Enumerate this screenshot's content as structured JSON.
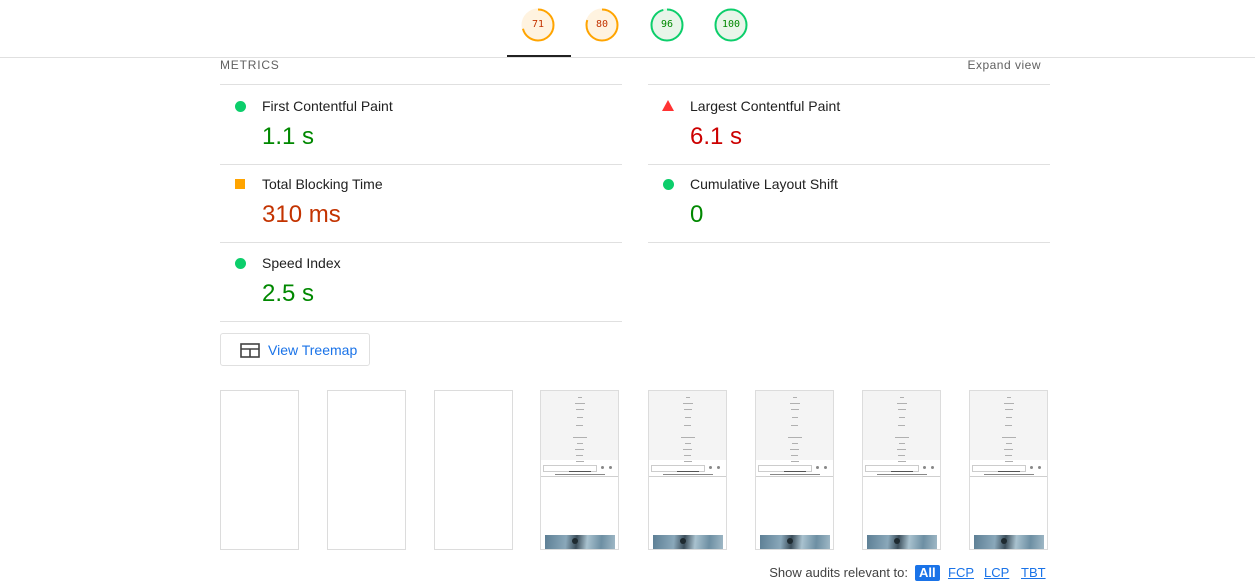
{
  "gauges": [
    {
      "score": "71",
      "color": "#ffa400",
      "fill": "#fff3e0",
      "text": "#c33300",
      "fraction": 0.71
    },
    {
      "score": "80",
      "color": "#ffa400",
      "fill": "#fff3e0",
      "text": "#c33300",
      "fraction": 0.8
    },
    {
      "score": "96",
      "color": "#0cce6b",
      "fill": "#e8f5e9",
      "text": "#008800",
      "fraction": 0.96
    },
    {
      "score": "100",
      "color": "#0cce6b",
      "fill": "#e8f5e9",
      "text": "#008800",
      "fraction": 1.0
    }
  ],
  "metrics": {
    "title": "METRICS",
    "expand_label": "Expand view",
    "items": [
      {
        "title": "First Contentful Paint",
        "value": "1.1 s",
        "status": "pass",
        "icon": "green-circle-icon"
      },
      {
        "title": "Largest Contentful Paint",
        "value": "6.1 s",
        "status": "fail",
        "icon": "red-triangle-icon"
      },
      {
        "title": "Total Blocking Time",
        "value": "310 ms",
        "status": "average",
        "icon": "orange-square-icon"
      },
      {
        "title": "Cumulative Layout Shift",
        "value": "0",
        "status": "pass",
        "icon": "green-circle-icon"
      },
      {
        "title": "Speed Index",
        "value": "2.5 s",
        "status": "pass",
        "icon": "green-circle-icon"
      }
    ]
  },
  "treemap": {
    "label": "View Treemap",
    "icon": "treemap-icon"
  },
  "filmstrip": {
    "frames": [
      {
        "state": "blank"
      },
      {
        "state": "blank"
      },
      {
        "state": "blank"
      },
      {
        "state": "rendered"
      },
      {
        "state": "rendered"
      },
      {
        "state": "rendered"
      },
      {
        "state": "rendered"
      },
      {
        "state": "rendered"
      }
    ]
  },
  "audit_filter": {
    "label": "Show audits relevant to:",
    "options": [
      "All",
      "FCP",
      "LCP",
      "TBT"
    ],
    "selected": "All"
  },
  "colors": {
    "accent": "#1a73e8",
    "pass": "#0cce6b",
    "average": "#ffa400",
    "fail": "#ff3333"
  }
}
